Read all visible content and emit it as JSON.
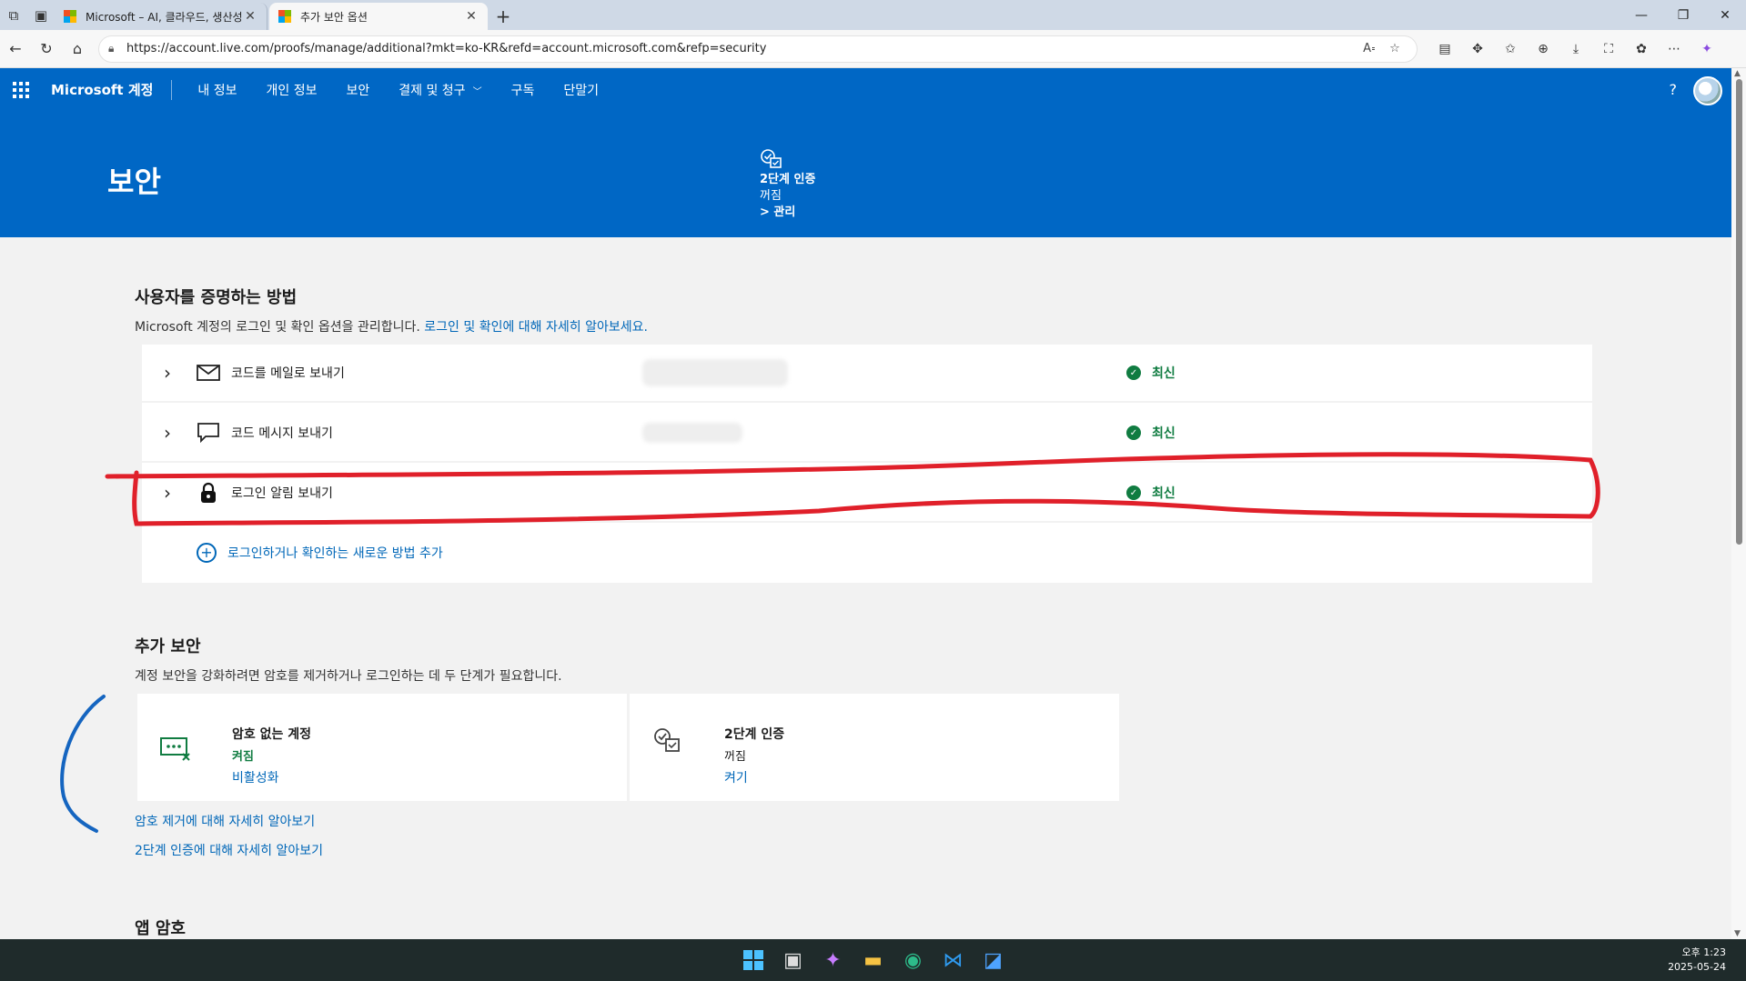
{
  "browser": {
    "tabs": [
      {
        "title": "Microsoft – AI, 클라우드, 생산성, 컴퓨팅",
        "active": false
      },
      {
        "title": "추가 보안 옵션",
        "active": true
      }
    ],
    "url": "https://account.live.com/proofs/manage/additional?mkt=ko-KR&refd=account.microsoft.com&refp=security"
  },
  "header": {
    "brand": "Microsoft 계정",
    "nav": [
      "내 정보",
      "개인 정보",
      "보안",
      "결제 및 청구",
      "구독",
      "단말기"
    ],
    "help": "?",
    "page_title": "보안",
    "two_step": {
      "label": "2단계 인증",
      "status": "꺼짐",
      "manage": "> 관리"
    }
  },
  "proofs_section": {
    "title": "사용자를 증명하는 방법",
    "desc": "Microsoft 계정의 로그인 및 확인 옵션을 관리합니다.",
    "desc_link": "로그인 및 확인에 대해 자세히 알아보세요.",
    "items": [
      {
        "label": "코드를 메일로 보내기",
        "status": "최신",
        "icon": "mail-icon"
      },
      {
        "label": "코드 메시지 보내기",
        "status": "최신",
        "icon": "message-icon"
      },
      {
        "label": "로그인 알림 보내기",
        "status": "최신",
        "icon": "lock-icon"
      }
    ],
    "add": "로그인하거나 확인하는 새로운 방법 추가"
  },
  "extra_section": {
    "title": "추가 보안",
    "desc": "계정 보안을 강화하려면 암호를 제거하거나 로그인하는 데 두 단계가 필요합니다.",
    "cards": [
      {
        "title": "암호 없는 계정",
        "status": "켜짐",
        "action": "비활성화"
      },
      {
        "title": "2단계 인증",
        "status": "꺼짐",
        "action": "켜기"
      }
    ],
    "links": [
      "암호 제거에 대해 자세히 알아보기",
      "2단계 인증에 대해 자세히 알아보기"
    ]
  },
  "app_password": {
    "title": "앱 암호"
  },
  "taskbar": {
    "time": "오후 1:23",
    "date": "2025-05-24"
  },
  "colors": {
    "brand_blue": "#0067c5",
    "ok_green": "#107c41",
    "link_blue": "#0067b8",
    "annotation_red": "#e0202a",
    "annotation_blue": "#1565c0"
  }
}
